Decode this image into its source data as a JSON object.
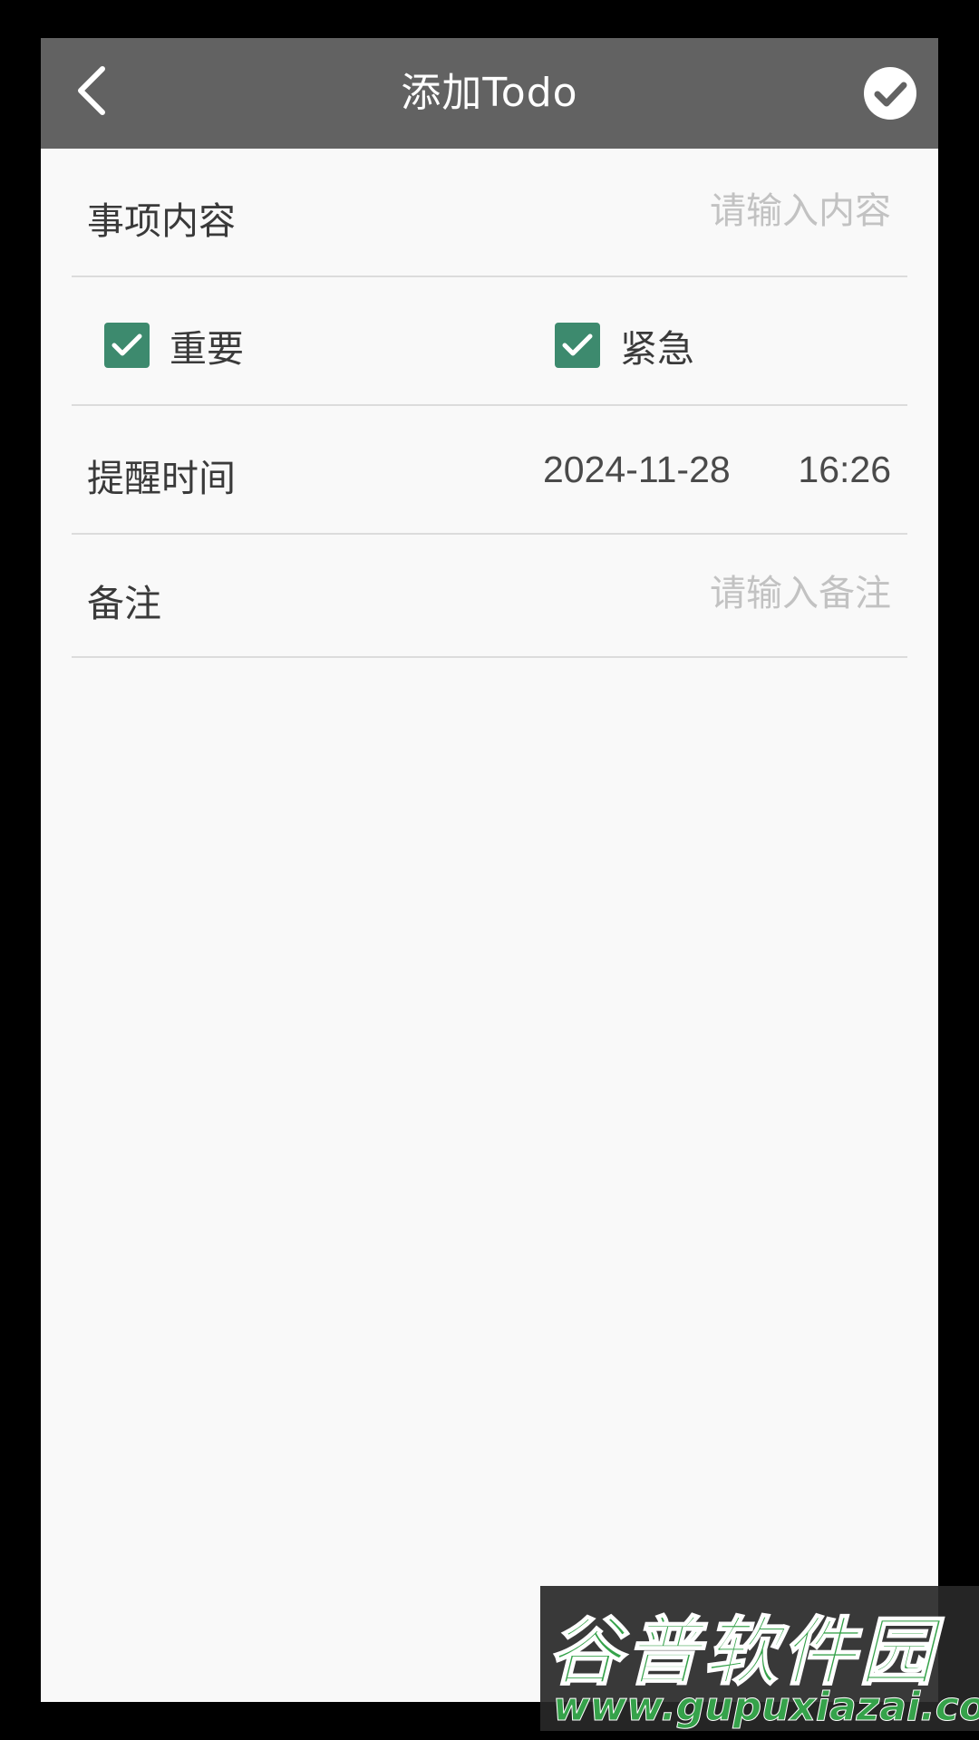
{
  "header": {
    "title": "添加Todo",
    "back_icon": "chevron-left-icon",
    "confirm_icon": "check-circle-icon"
  },
  "content_row": {
    "label": "事项内容",
    "placeholder": "请输入内容",
    "value": ""
  },
  "flags": {
    "important": {
      "label": "重要",
      "checked": true
    },
    "urgent": {
      "label": "紧急",
      "checked": true
    }
  },
  "reminder_row": {
    "label": "提醒时间",
    "date": "2024-11-28",
    "time": "16:26"
  },
  "note_row": {
    "label": "备注",
    "placeholder": "请输入备注",
    "value": ""
  },
  "watermark": {
    "brand": "谷普软件园",
    "url": "www.gupuxiazai.com"
  },
  "colors": {
    "header_bg": "#626262",
    "checkbox": "#3d8a6e",
    "page_bg": "#f9f9f9",
    "placeholder": "#c2c2c2"
  }
}
